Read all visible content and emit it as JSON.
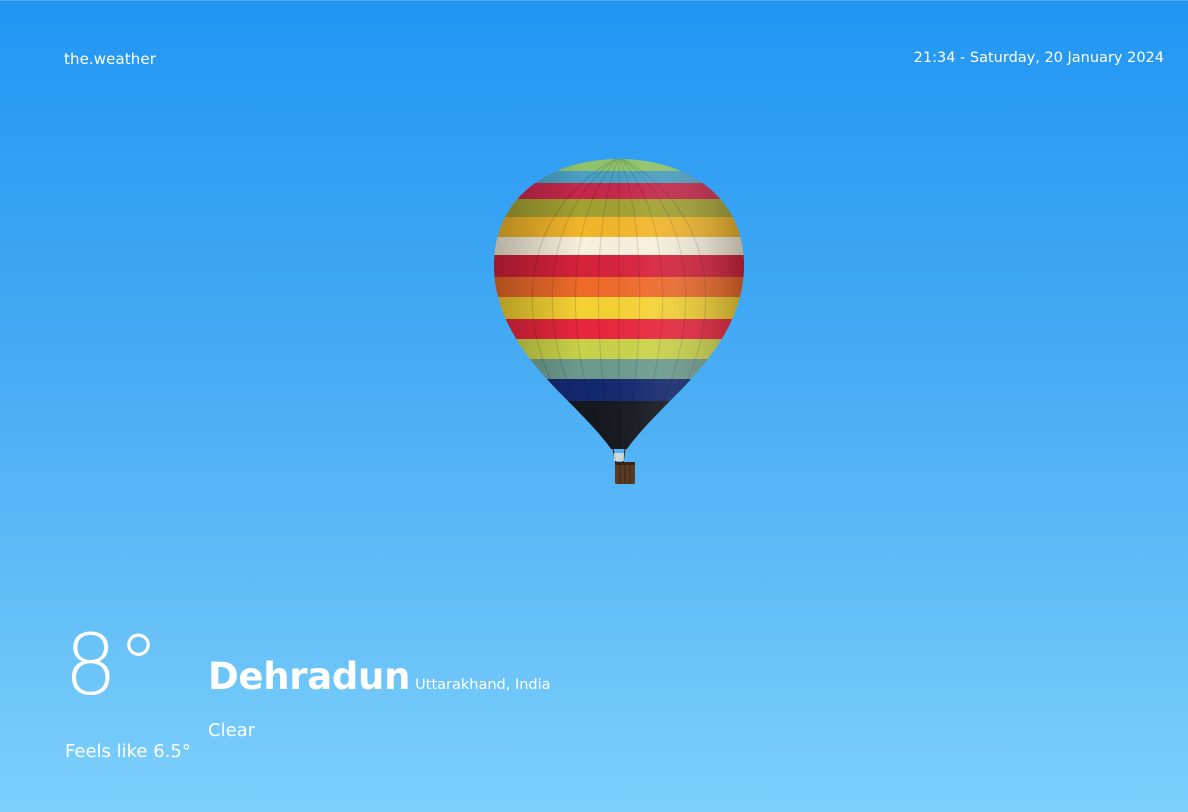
{
  "header": {
    "brand": "the.weather",
    "datetime": "21:34 - Saturday, 20 January 2024"
  },
  "illustration": {
    "icon": "hot-air-balloon-icon"
  },
  "weather": {
    "temperature": "8°",
    "feels_like": "Feels like 6.5°",
    "city": "Dehradun",
    "region": "Uttarakhand, India",
    "condition": "Clear"
  },
  "colors": {
    "sky_top": "#2196f3",
    "sky_bottom": "#7dd0fb",
    "text": "#ffffff"
  }
}
